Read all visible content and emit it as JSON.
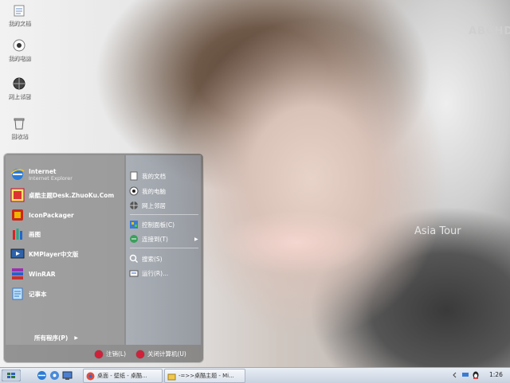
{
  "desktop": {
    "icons": [
      {
        "label": "我的文档"
      },
      {
        "label": "我的电脑"
      },
      {
        "label": "网上邻居"
      },
      {
        "label": "回收站"
      }
    ],
    "watermarks": [
      "ABCHD",
      "Asia Tour"
    ]
  },
  "start_menu": {
    "pinned": [
      {
        "label": "Internet",
        "sub": "Internet Explorer"
      },
      {
        "label": "桌酷主题Desk.ZhuoKu.Com"
      },
      {
        "label": "IconPackager"
      },
      {
        "label": "画图"
      },
      {
        "label": "KMPlayer中文版"
      },
      {
        "label": "WinRAR"
      },
      {
        "label": "记事本"
      }
    ],
    "all_programs": "所有程序(P)",
    "right_items": [
      {
        "label": "我的文档"
      },
      {
        "label": "我的电脑"
      },
      {
        "label": "网上邻居"
      },
      {
        "label": "控制面板(C)"
      },
      {
        "label": "连接到(T)"
      },
      {
        "label": "搜索(S)"
      },
      {
        "label": "运行(R)..."
      }
    ],
    "logoff": "注销(L)",
    "shutdown": "关闭计算机(U)"
  },
  "taskbar": {
    "tasks": [
      {
        "label": "桌面 - 壁纸 - 桌酷..."
      },
      {
        "label": "-=>>桌酷主题 - Mi..."
      }
    ],
    "clock": "1:26"
  },
  "colors": {
    "shutdown_red": "#d0213b",
    "taskbar": "#d5dde8"
  }
}
